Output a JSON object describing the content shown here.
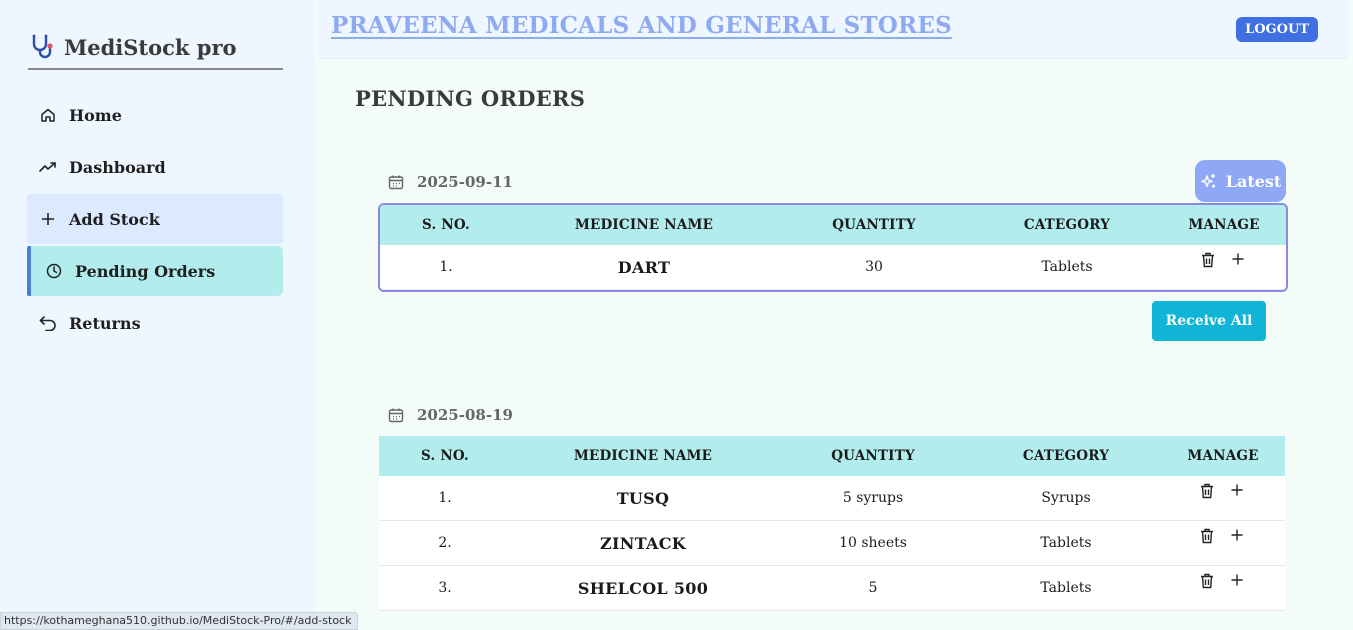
{
  "brand": {
    "name": "MediStock pro"
  },
  "nav": [
    {
      "label": "Home",
      "icon": "home-icon"
    },
    {
      "label": "Dashboard",
      "icon": "trend-icon"
    },
    {
      "label": "Add Stock",
      "icon": "plus-icon"
    },
    {
      "label": "Pending Orders",
      "icon": "clock-icon"
    },
    {
      "label": "Returns",
      "icon": "undo-icon"
    }
  ],
  "header": {
    "store_name": "PRAVEENA MEDICALS AND GENERAL STORES",
    "logout_label": "LOGOUT"
  },
  "page": {
    "title": "PENDING ORDERS"
  },
  "columns": [
    "S. NO.",
    "MEDICINE NAME",
    "QUANTITY",
    "CATEGORY",
    "MANAGE"
  ],
  "orders": [
    {
      "date": "2025-09-11",
      "badge": "Latest",
      "rows": [
        {
          "sno": "1.",
          "name": "DART",
          "qty": "30",
          "category": "Tablets"
        }
      ],
      "action": "Receive All"
    },
    {
      "date": "2025-08-19",
      "rows": [
        {
          "sno": "1.",
          "name": "TUSQ",
          "qty": "5 syrups",
          "category": "Syrups"
        },
        {
          "sno": "2.",
          "name": "ZINTACK",
          "qty": "10 sheets",
          "category": "Tablets"
        },
        {
          "sno": "3.",
          "name": "SHELCOL 500",
          "qty": "5",
          "category": "Tablets"
        }
      ]
    }
  ],
  "status_bar": {
    "url": "https://kothameghana510.github.io/MediStock-Pro/#/add-stock"
  },
  "colors": {
    "accent": "#3f6fe0",
    "active_nav": "#b2ecec",
    "receive": "#10b4d4",
    "latest": "#8ea8f5"
  }
}
